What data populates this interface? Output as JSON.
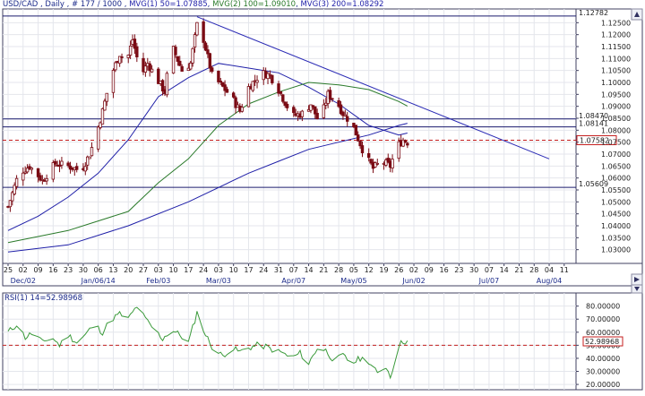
{
  "header": {
    "symbol_line": "USD/CAD , Daily , # 177 / 1000 , ",
    "mvg1_label": "MVG(1) 50=1.07885",
    "mvg2_label": "MVG(2) 100=1.09010",
    "mvg3_label": "MVG(3) 200=1.08292",
    "rsi_label": "RSI(1) 14=52.98968",
    "price_axis_icon": "price-axis-arrow-icon",
    "time_axis_icon": "time-axis-arrow-icon",
    "rsi_axis_icon": "rsi-axis-arrow-icon"
  },
  "colors": {
    "candle": "#7a0b14",
    "mvg1": "#1f1fa8",
    "mvg2": "#2a7a2a",
    "mvg3": "#1f1fa8",
    "trendline": "#2b2bb5",
    "level": "#1a1a6e",
    "current": "#c41e1e",
    "rsi": "#3a9a3a",
    "grid": "#e4e6ec"
  },
  "chart_data": [
    {
      "type": "candlestick",
      "name": "USD/CAD Daily",
      "ylim": [
        1.025,
        1.13
      ],
      "y_ticks": [
        "1.12500",
        "1.12000",
        "1.11500",
        "1.11000",
        "1.10500",
        "1.10000",
        "1.09500",
        "1.09000",
        "1.08500",
        "1.08000",
        "1.07500",
        "1.07000",
        "1.06500",
        "1.06000",
        "1.05500",
        "1.05000",
        "1.04500",
        "1.04000",
        "1.03500",
        "1.03000"
      ],
      "y_tick_values": [
        1.125,
        1.12,
        1.115,
        1.11,
        1.105,
        1.1,
        1.095,
        1.09,
        1.085,
        1.08,
        1.075,
        1.07,
        1.065,
        1.06,
        1.055,
        1.05,
        1.045,
        1.04,
        1.035,
        1.03
      ],
      "x_tick_labels": [
        "25",
        "02",
        "09",
        "16",
        "23",
        "30",
        "06",
        "13",
        "20",
        "27",
        "03",
        "10",
        "17",
        "24",
        "03",
        "10",
        "17",
        "24",
        "31",
        "07",
        "14",
        "21",
        "28",
        "05",
        "12",
        "19",
        "26",
        "02",
        "09",
        "16",
        "23",
        "30",
        "07",
        "14",
        "21",
        "28",
        "04",
        "11"
      ],
      "x_tick_days": [
        0,
        7,
        14,
        21,
        28,
        35,
        42,
        49,
        56,
        63,
        70,
        77,
        84,
        91,
        98,
        105,
        112,
        119,
        126,
        133,
        140,
        147,
        154,
        161,
        168,
        175,
        182,
        189,
        196,
        203,
        210,
        217,
        224,
        231,
        238,
        245,
        252,
        259
      ],
      "month_labels": [
        "Dec/02",
        "Jan/06/14",
        "Feb/03",
        "Mar/03",
        "Apr/07",
        "May/05",
        "Jun/02",
        "Jul/07",
        "Aug/04"
      ],
      "month_days": [
        7,
        42,
        70,
        98,
        133,
        161,
        189,
        224,
        252
      ],
      "levels": [
        {
          "label": "1.12782",
          "value": 1.12782,
          "style": "solid"
        },
        {
          "label": "1.08470",
          "value": 1.0847,
          "style": "solid"
        },
        {
          "label": "1.08141",
          "value": 1.08141,
          "style": "solid"
        },
        {
          "label": "1.05609",
          "value": 1.05609,
          "style": "solid"
        }
      ],
      "current_price": {
        "label": "1.07582",
        "value": 1.07582
      },
      "trendline": {
        "from": {
          "day": 88,
          "value": 1.1275
        },
        "to": {
          "day": 252,
          "value": 1.068
        }
      },
      "close_anchors": [
        [
          0,
          1.048
        ],
        [
          5,
          1.062
        ],
        [
          10,
          1.065
        ],
        [
          16,
          1.059
        ],
        [
          22,
          1.066
        ],
        [
          28,
          1.065
        ],
        [
          34,
          1.063
        ],
        [
          38,
          1.07
        ],
        [
          41,
          1.078
        ],
        [
          44,
          1.088
        ],
        [
          48,
          1.103
        ],
        [
          52,
          1.112
        ],
        [
          55,
          1.108
        ],
        [
          58,
          1.118
        ],
        [
          62,
          1.103
        ],
        [
          65,
          1.108
        ],
        [
          69,
          1.102
        ],
        [
          73,
          1.096
        ],
        [
          76,
          1.116
        ],
        [
          81,
          1.105
        ],
        [
          85,
          1.108
        ],
        [
          88,
          1.124
        ],
        [
          91,
          1.118
        ],
        [
          95,
          1.103
        ],
        [
          100,
          1.098
        ],
        [
          104,
          1.094
        ],
        [
          108,
          1.088
        ],
        [
          112,
          1.098
        ],
        [
          118,
          1.104
        ],
        [
          122,
          1.103
        ],
        [
          126,
          1.097
        ],
        [
          130,
          1.09
        ],
        [
          133,
          1.086
        ],
        [
          137,
          1.087
        ],
        [
          141,
          1.091
        ],
        [
          145,
          1.083
        ],
        [
          149,
          1.095
        ],
        [
          153,
          1.092
        ],
        [
          156,
          1.087
        ],
        [
          160,
          1.083
        ],
        [
          166,
          1.07
        ],
        [
          170,
          1.064
        ],
        [
          174,
          1.067
        ],
        [
          178,
          1.065
        ],
        [
          181,
          1.073
        ],
        [
          184,
          1.076
        ],
        [
          186,
          1.075
        ]
      ],
      "mvg": [
        {
          "name": "MVG(1) 50",
          "points": [
            [
              0,
              1.038
            ],
            [
              14,
              1.044
            ],
            [
              28,
              1.052
            ],
            [
              42,
              1.062
            ],
            [
              56,
              1.076
            ],
            [
              70,
              1.094
            ],
            [
              84,
              1.102
            ],
            [
              98,
              1.108
            ],
            [
              112,
              1.106
            ],
            [
              126,
              1.104
            ],
            [
              140,
              1.098
            ],
            [
              154,
              1.091
            ],
            [
              168,
              1.082
            ],
            [
              182,
              1.078
            ],
            [
              186,
              1.0788
            ]
          ]
        },
        {
          "name": "MVG(2) 100",
          "points": [
            [
              0,
              1.033
            ],
            [
              28,
              1.038
            ],
            [
              56,
              1.046
            ],
            [
              70,
              1.058
            ],
            [
              84,
              1.068
            ],
            [
              98,
              1.082
            ],
            [
              112,
              1.091
            ],
            [
              126,
              1.096
            ],
            [
              140,
              1.1
            ],
            [
              154,
              1.099
            ],
            [
              168,
              1.097
            ],
            [
              182,
              1.092
            ],
            [
              186,
              1.0901
            ]
          ]
        },
        {
          "name": "MVG(3) 200",
          "points": [
            [
              0,
              1.029
            ],
            [
              28,
              1.032
            ],
            [
              56,
              1.04
            ],
            [
              84,
              1.05
            ],
            [
              112,
              1.062
            ],
            [
              126,
              1.067
            ],
            [
              140,
              1.072
            ],
            [
              154,
              1.075
            ],
            [
              168,
              1.078
            ],
            [
              182,
              1.082
            ],
            [
              186,
              1.0829
            ]
          ]
        }
      ]
    },
    {
      "type": "line",
      "name": "RSI(1) 14",
      "ylim": [
        18,
        88
      ],
      "y_ticks": [
        "80.00000",
        "70.00000",
        "60.00000",
        "50.00000",
        "40.00000",
        "30.00000",
        "20.00000"
      ],
      "y_tick_values": [
        80,
        70,
        60,
        50,
        40,
        30,
        20
      ],
      "level": 50,
      "current": {
        "label": "52.98968",
        "value": 52.98968
      },
      "anchors": [
        [
          0,
          60
        ],
        [
          4,
          66
        ],
        [
          8,
          56
        ],
        [
          12,
          60
        ],
        [
          16,
          52
        ],
        [
          20,
          57
        ],
        [
          24,
          50
        ],
        [
          28,
          58
        ],
        [
          32,
          52
        ],
        [
          36,
          58
        ],
        [
          40,
          66
        ],
        [
          44,
          60
        ],
        [
          48,
          70
        ],
        [
          52,
          74
        ],
        [
          56,
          70
        ],
        [
          60,
          80
        ],
        [
          64,
          70
        ],
        [
          68,
          62
        ],
        [
          72,
          55
        ],
        [
          76,
          62
        ],
        [
          80,
          58
        ],
        [
          84,
          52
        ],
        [
          88,
          75
        ],
        [
          92,
          58
        ],
        [
          96,
          46
        ],
        [
          100,
          42
        ],
        [
          104,
          48
        ],
        [
          108,
          45
        ],
        [
          112,
          48
        ],
        [
          116,
          50
        ],
        [
          120,
          49
        ],
        [
          124,
          46
        ],
        [
          128,
          44
        ],
        [
          132,
          40
        ],
        [
          136,
          44
        ],
        [
          140,
          36
        ],
        [
          144,
          48
        ],
        [
          148,
          46
        ],
        [
          152,
          38
        ],
        [
          156,
          42
        ],
        [
          160,
          36
        ],
        [
          164,
          40
        ],
        [
          168,
          38
        ],
        [
          172,
          28
        ],
        [
          176,
          34
        ],
        [
          178,
          26
        ],
        [
          180,
          38
        ],
        [
          182,
          50
        ],
        [
          184,
          53
        ],
        [
          186,
          53
        ]
      ]
    }
  ]
}
